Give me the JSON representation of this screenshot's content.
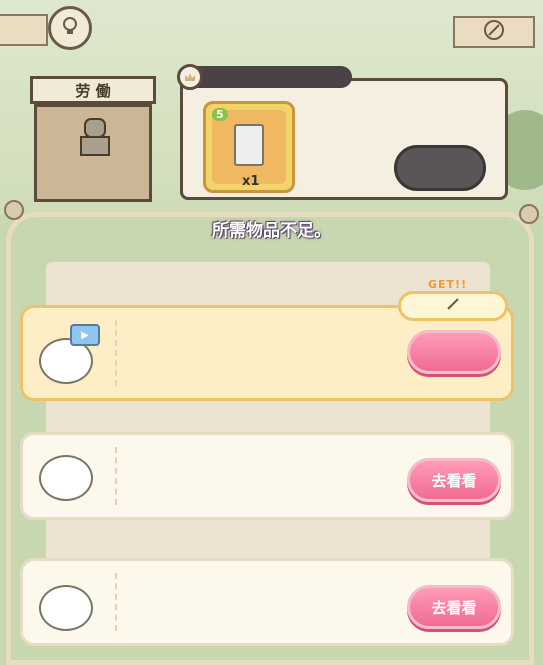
{
  "top_bar": {
    "left_icon": "lightbulb-icon",
    "right_icon": "compass-icon"
  },
  "stall": {
    "sign": "劳 働",
    "icon": "knight-icon"
  },
  "reward_panel": {
    "card": {
      "star_level": "5",
      "quantity": "x1",
      "icon": "phone-icon"
    }
  },
  "message": "所需物品不足。",
  "tasks": [
    {
      "icon": "video-icon",
      "button": "",
      "badge": "GET!!"
    },
    {
      "icon": "chiikawa-icon",
      "button": "去看看"
    },
    {
      "icon": "hachiware-icon",
      "button": "去看看"
    }
  ],
  "colors": {
    "accent": "#f06c91",
    "highlight": "#f0c267",
    "frame": "#5c4a3a"
  }
}
